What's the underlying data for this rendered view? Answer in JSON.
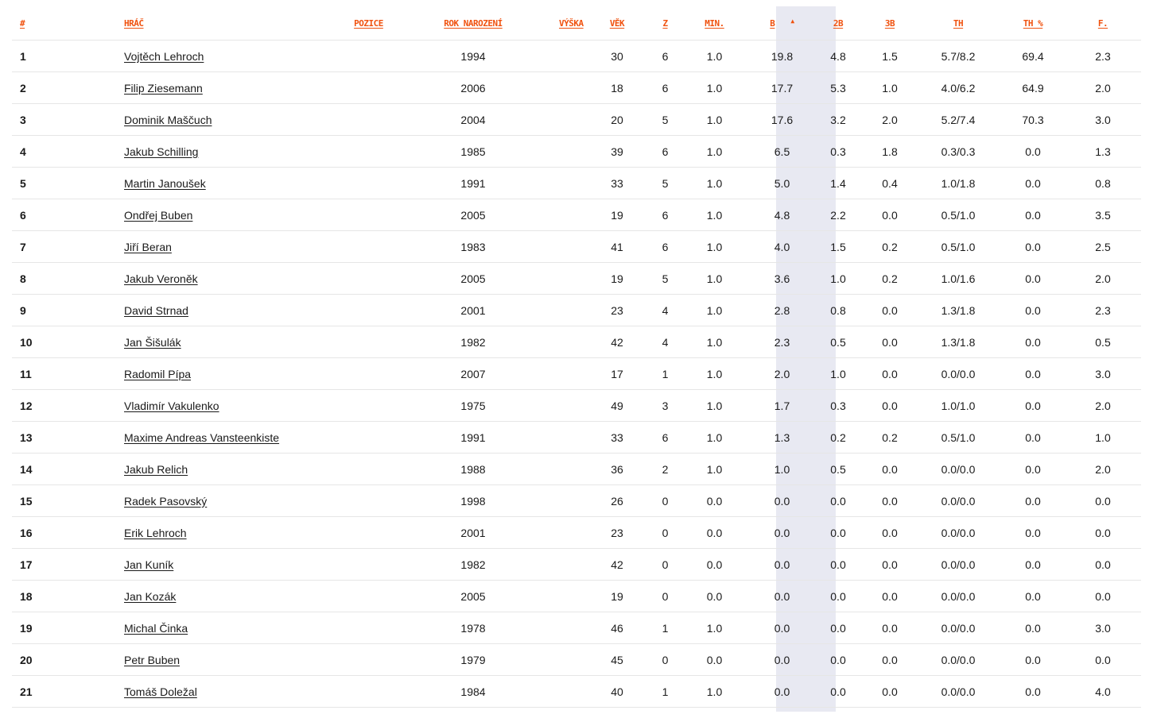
{
  "table": {
    "headers": {
      "rank": "#",
      "player": "HRÁČ",
      "position": "POZICE",
      "birth_year": "ROK NAROZENÍ",
      "height": "VÝŠKA",
      "age": "VĚK",
      "games": "Z",
      "minutes": "MIN.",
      "points": "B",
      "two_pt": "2B",
      "three_pt": "3B",
      "free_throws": "TH",
      "free_throw_pct": "TH %",
      "fouls": "F."
    },
    "sorted_column": "points",
    "sort_direction": "desc",
    "colors": {
      "header_text": "#f0520f",
      "sorted_column_bg": "#e8e9f2",
      "row_divider": "#e6e6e6",
      "text": "#1a1a1a"
    },
    "rows": [
      {
        "rank": "1",
        "name": "Vojtěch Lehroch",
        "position": "",
        "birth_year": "1994",
        "height": "",
        "age": "30",
        "games": "6",
        "minutes": "1.0",
        "points": "19.8",
        "two_pt": "4.8",
        "three_pt": "1.5",
        "free_throws": "5.7/8.2",
        "free_throw_pct": "69.4",
        "fouls": "2.3"
      },
      {
        "rank": "2",
        "name": "Filip Ziesemann",
        "position": "",
        "birth_year": "2006",
        "height": "",
        "age": "18",
        "games": "6",
        "minutes": "1.0",
        "points": "17.7",
        "two_pt": "5.3",
        "three_pt": "1.0",
        "free_throws": "4.0/6.2",
        "free_throw_pct": "64.9",
        "fouls": "2.0"
      },
      {
        "rank": "3",
        "name": "Dominik Maščuch",
        "position": "",
        "birth_year": "2004",
        "height": "",
        "age": "20",
        "games": "5",
        "minutes": "1.0",
        "points": "17.6",
        "two_pt": "3.2",
        "three_pt": "2.0",
        "free_throws": "5.2/7.4",
        "free_throw_pct": "70.3",
        "fouls": "3.0"
      },
      {
        "rank": "4",
        "name": "Jakub Schilling",
        "position": "",
        "birth_year": "1985",
        "height": "",
        "age": "39",
        "games": "6",
        "minutes": "1.0",
        "points": "6.5",
        "two_pt": "0.3",
        "three_pt": "1.8",
        "free_throws": "0.3/0.3",
        "free_throw_pct": "0.0",
        "fouls": "1.3"
      },
      {
        "rank": "5",
        "name": "Martin Janoušek",
        "position": "",
        "birth_year": "1991",
        "height": "",
        "age": "33",
        "games": "5",
        "minutes": "1.0",
        "points": "5.0",
        "two_pt": "1.4",
        "three_pt": "0.4",
        "free_throws": "1.0/1.8",
        "free_throw_pct": "0.0",
        "fouls": "0.8"
      },
      {
        "rank": "6",
        "name": "Ondřej Buben",
        "position": "",
        "birth_year": "2005",
        "height": "",
        "age": "19",
        "games": "6",
        "minutes": "1.0",
        "points": "4.8",
        "two_pt": "2.2",
        "three_pt": "0.0",
        "free_throws": "0.5/1.0",
        "free_throw_pct": "0.0",
        "fouls": "3.5"
      },
      {
        "rank": "7",
        "name": "Jiří Beran",
        "position": "",
        "birth_year": "1983",
        "height": "",
        "age": "41",
        "games": "6",
        "minutes": "1.0",
        "points": "4.0",
        "two_pt": "1.5",
        "three_pt": "0.2",
        "free_throws": "0.5/1.0",
        "free_throw_pct": "0.0",
        "fouls": "2.5"
      },
      {
        "rank": "8",
        "name": "Jakub Veroněk",
        "position": "",
        "birth_year": "2005",
        "height": "",
        "age": "19",
        "games": "5",
        "minutes": "1.0",
        "points": "3.6",
        "two_pt": "1.0",
        "three_pt": "0.2",
        "free_throws": "1.0/1.6",
        "free_throw_pct": "0.0",
        "fouls": "2.0"
      },
      {
        "rank": "9",
        "name": "David Strnad",
        "position": "",
        "birth_year": "2001",
        "height": "",
        "age": "23",
        "games": "4",
        "minutes": "1.0",
        "points": "2.8",
        "two_pt": "0.8",
        "three_pt": "0.0",
        "free_throws": "1.3/1.8",
        "free_throw_pct": "0.0",
        "fouls": "2.3"
      },
      {
        "rank": "10",
        "name": "Jan Šišulák",
        "position": "",
        "birth_year": "1982",
        "height": "",
        "age": "42",
        "games": "4",
        "minutes": "1.0",
        "points": "2.3",
        "two_pt": "0.5",
        "three_pt": "0.0",
        "free_throws": "1.3/1.8",
        "free_throw_pct": "0.0",
        "fouls": "0.5"
      },
      {
        "rank": "11",
        "name": "Radomil Pípa",
        "position": "",
        "birth_year": "2007",
        "height": "",
        "age": "17",
        "games": "1",
        "minutes": "1.0",
        "points": "2.0",
        "two_pt": "1.0",
        "three_pt": "0.0",
        "free_throws": "0.0/0.0",
        "free_throw_pct": "0.0",
        "fouls": "3.0"
      },
      {
        "rank": "12",
        "name": "Vladimír Vakulenko",
        "position": "",
        "birth_year": "1975",
        "height": "",
        "age": "49",
        "games": "3",
        "minutes": "1.0",
        "points": "1.7",
        "two_pt": "0.3",
        "three_pt": "0.0",
        "free_throws": "1.0/1.0",
        "free_throw_pct": "0.0",
        "fouls": "2.0"
      },
      {
        "rank": "13",
        "name": "Maxime Andreas Vansteenkiste",
        "position": "",
        "birth_year": "1991",
        "height": "",
        "age": "33",
        "games": "6",
        "minutes": "1.0",
        "points": "1.3",
        "two_pt": "0.2",
        "three_pt": "0.2",
        "free_throws": "0.5/1.0",
        "free_throw_pct": "0.0",
        "fouls": "1.0"
      },
      {
        "rank": "14",
        "name": "Jakub Relich",
        "position": "",
        "birth_year": "1988",
        "height": "",
        "age": "36",
        "games": "2",
        "minutes": "1.0",
        "points": "1.0",
        "two_pt": "0.5",
        "three_pt": "0.0",
        "free_throws": "0.0/0.0",
        "free_throw_pct": "0.0",
        "fouls": "2.0"
      },
      {
        "rank": "15",
        "name": "Radek Pasovský",
        "position": "",
        "birth_year": "1998",
        "height": "",
        "age": "26",
        "games": "0",
        "minutes": "0.0",
        "points": "0.0",
        "two_pt": "0.0",
        "three_pt": "0.0",
        "free_throws": "0.0/0.0",
        "free_throw_pct": "0.0",
        "fouls": "0.0"
      },
      {
        "rank": "16",
        "name": "Erik Lehroch",
        "position": "",
        "birth_year": "2001",
        "height": "",
        "age": "23",
        "games": "0",
        "minutes": "0.0",
        "points": "0.0",
        "two_pt": "0.0",
        "three_pt": "0.0",
        "free_throws": "0.0/0.0",
        "free_throw_pct": "0.0",
        "fouls": "0.0"
      },
      {
        "rank": "17",
        "name": "Jan Kuník",
        "position": "",
        "birth_year": "1982",
        "height": "",
        "age": "42",
        "games": "0",
        "minutes": "0.0",
        "points": "0.0",
        "two_pt": "0.0",
        "three_pt": "0.0",
        "free_throws": "0.0/0.0",
        "free_throw_pct": "0.0",
        "fouls": "0.0"
      },
      {
        "rank": "18",
        "name": "Jan Kozák",
        "position": "",
        "birth_year": "2005",
        "height": "",
        "age": "19",
        "games": "0",
        "minutes": "0.0",
        "points": "0.0",
        "two_pt": "0.0",
        "three_pt": "0.0",
        "free_throws": "0.0/0.0",
        "free_throw_pct": "0.0",
        "fouls": "0.0"
      },
      {
        "rank": "19",
        "name": "Michal Činka",
        "position": "",
        "birth_year": "1978",
        "height": "",
        "age": "46",
        "games": "1",
        "minutes": "1.0",
        "points": "0.0",
        "two_pt": "0.0",
        "three_pt": "0.0",
        "free_throws": "0.0/0.0",
        "free_throw_pct": "0.0",
        "fouls": "3.0"
      },
      {
        "rank": "20",
        "name": "Petr Buben",
        "position": "",
        "birth_year": "1979",
        "height": "",
        "age": "45",
        "games": "0",
        "minutes": "0.0",
        "points": "0.0",
        "two_pt": "0.0",
        "three_pt": "0.0",
        "free_throws": "0.0/0.0",
        "free_throw_pct": "0.0",
        "fouls": "0.0"
      },
      {
        "rank": "21",
        "name": "Tomáš Doležal",
        "position": "",
        "birth_year": "1984",
        "height": "",
        "age": "40",
        "games": "1",
        "minutes": "1.0",
        "points": "0.0",
        "two_pt": "0.0",
        "three_pt": "0.0",
        "free_throws": "0.0/0.0",
        "free_throw_pct": "0.0",
        "fouls": "4.0"
      }
    ]
  }
}
